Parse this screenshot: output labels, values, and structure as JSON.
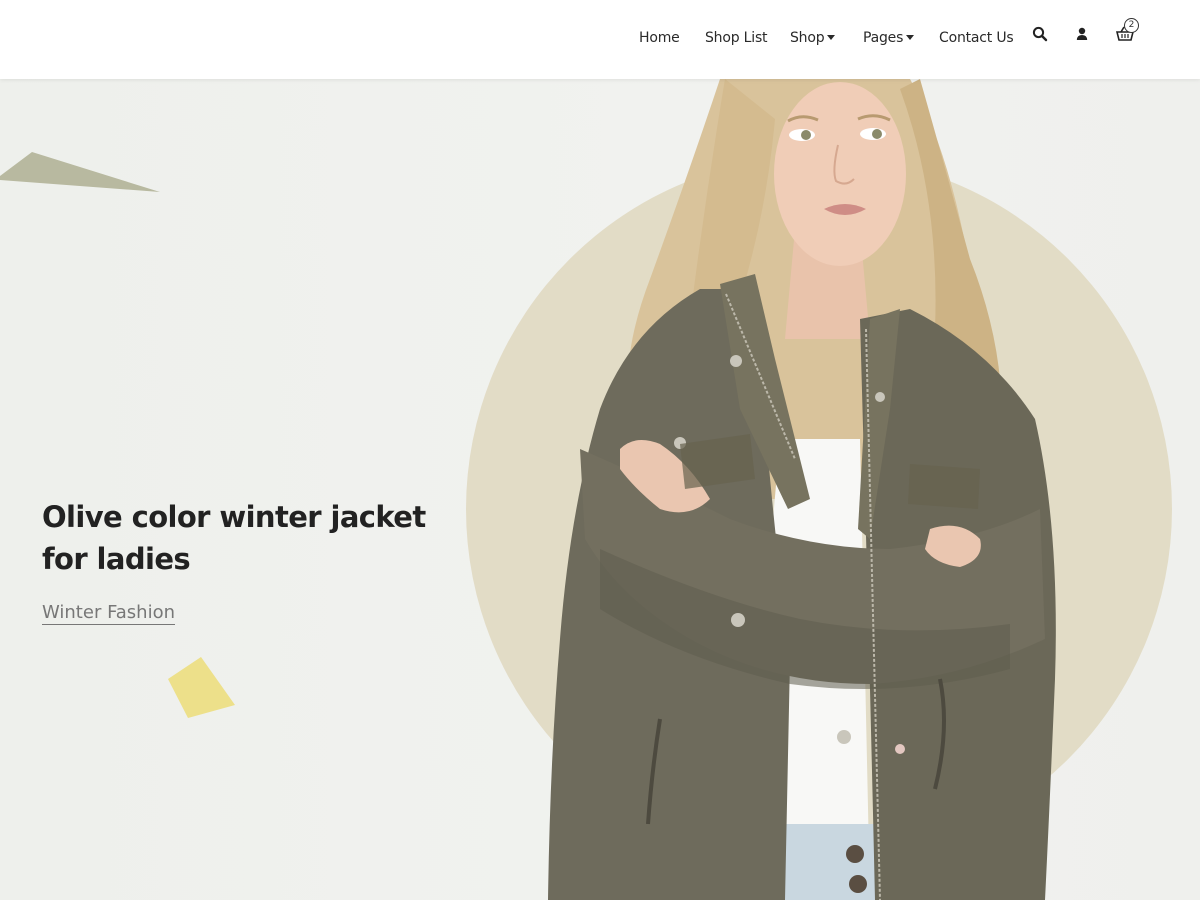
{
  "nav": {
    "home": "Home",
    "shop_list": "Shop List",
    "shop": "Shop",
    "pages": "Pages",
    "contact": "Contact Us",
    "search_icon": "search-icon",
    "user_icon": "user-icon",
    "cart_icon": "basket-icon",
    "cart_count": "2"
  },
  "hero": {
    "title": "Olive color winter jacket for ladies",
    "link": "Winter Fashion",
    "colors": {
      "circle": "#e2dcc6",
      "jacket": "#6e6b5c",
      "olive_shape": "#b8b9a0",
      "yellow_shape": "#ede08a"
    }
  }
}
